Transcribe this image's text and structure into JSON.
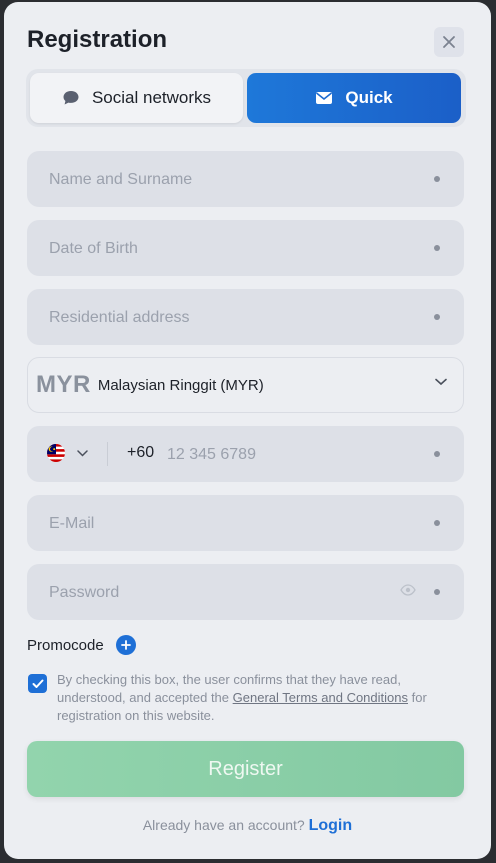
{
  "header": {
    "title": "Registration"
  },
  "tabs": [
    {
      "label": "Social networks",
      "icon": "chat-bubble-icon"
    },
    {
      "label": "Quick",
      "icon": "envelope-icon",
      "active": true
    }
  ],
  "fields": {
    "name": {
      "placeholder": "Name and Surname"
    },
    "dob": {
      "placeholder": "Date of Birth"
    },
    "address": {
      "placeholder": "Residential address"
    },
    "currency": {
      "code": "MYR",
      "name": "Malaysian Ringgit (MYR)"
    },
    "phone": {
      "prefix": "+60",
      "placeholder": "12 345 6789",
      "flag": "malaysia-flag-icon"
    },
    "email": {
      "placeholder": "E-Mail"
    },
    "password": {
      "placeholder": "Password"
    }
  },
  "promo": {
    "label": "Promocode"
  },
  "terms": {
    "checked": true,
    "text_before": "By checking this box, the user confirms that they have read, understood, and accepted the ",
    "link": "General Terms and Conditions",
    "text_after": " for registration on this website."
  },
  "register_label": "Register",
  "login": {
    "prompt": "Already have an account?",
    "link": "Login"
  },
  "colors": {
    "accent": "#1e6fd6",
    "register": "#8bcfa7",
    "background": "#eceef2"
  }
}
